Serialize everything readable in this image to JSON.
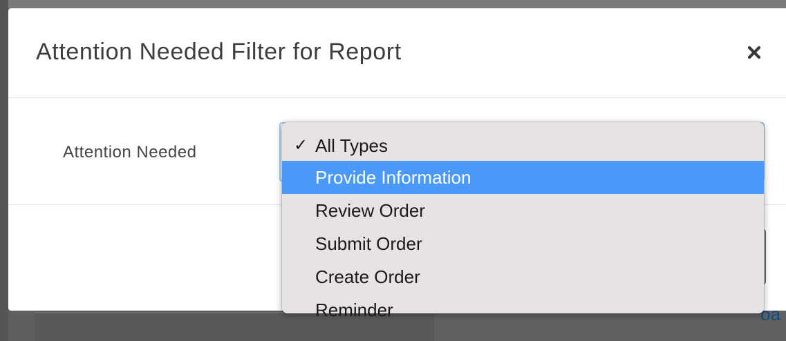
{
  "modal": {
    "title": "Attention Needed Filter for Report",
    "close_icon": "close-icon"
  },
  "filter": {
    "label": "Attention Needed",
    "selected_value": "All Types",
    "selected_mark": "✓",
    "options": [
      {
        "label": "All Types",
        "selected": true,
        "highlighted": false
      },
      {
        "label": "Provide Information",
        "selected": false,
        "highlighted": true
      },
      {
        "label": "Review Order",
        "selected": false,
        "highlighted": false
      },
      {
        "label": "Submit Order",
        "selected": false,
        "highlighted": false
      },
      {
        "label": "Create Order",
        "selected": false,
        "highlighted": false
      },
      {
        "label": "Reminder",
        "selected": false,
        "highlighted": false
      }
    ]
  },
  "background": {
    "link_fragment": "oa"
  },
  "colors": {
    "highlight": "#4a98f7",
    "dropdown_bg": "#e8e3e3",
    "focus_ring": "#9ccaf3",
    "overlay": "#5f5f5f",
    "link": "#0b4c86"
  }
}
